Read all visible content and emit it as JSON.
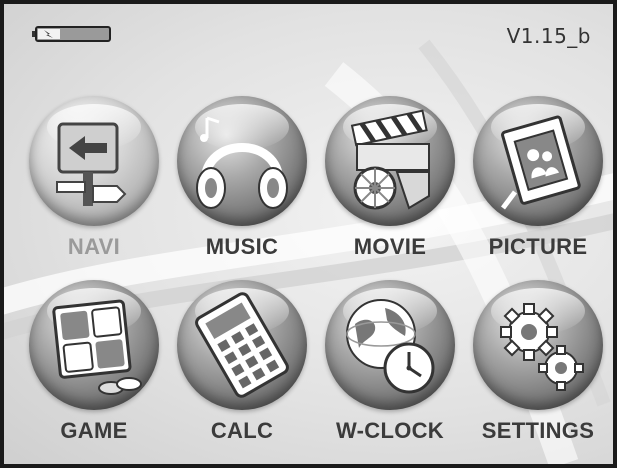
{
  "status_bar": {
    "version": "V1.15_b",
    "battery_icon": "battery-icon"
  },
  "menu": {
    "items": [
      {
        "label": "NAVI",
        "icon": "navigation-signpost-icon",
        "active": true
      },
      {
        "label": "MUSIC",
        "icon": "headphones-icon",
        "active": false
      },
      {
        "label": "MOVIE",
        "icon": "film-clapper-icon",
        "active": false
      },
      {
        "label": "PICTURE",
        "icon": "photo-frame-icon",
        "active": false
      },
      {
        "label": "GAME",
        "icon": "game-board-icon",
        "active": false
      },
      {
        "label": "CALC",
        "icon": "calculator-icon",
        "active": false
      },
      {
        "label": "W-CLOCK",
        "icon": "world-clock-icon",
        "active": false
      },
      {
        "label": "SETTINGS",
        "icon": "gears-icon",
        "active": false
      }
    ]
  }
}
